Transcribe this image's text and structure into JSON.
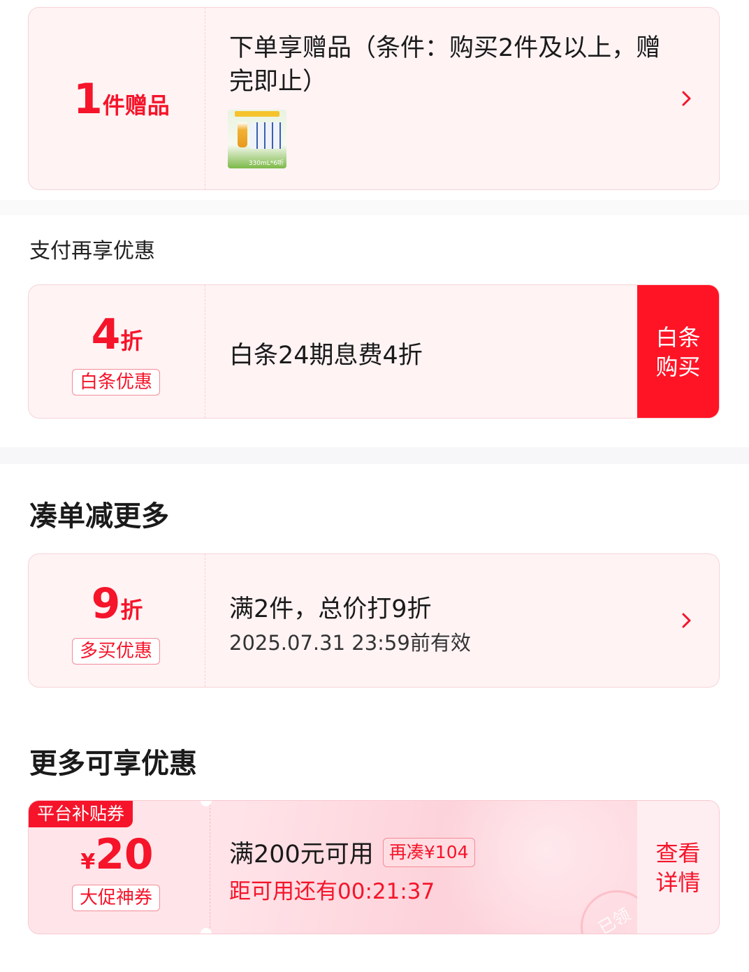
{
  "gift_card": {
    "count": "1",
    "unit": "件赠品",
    "title": "下单享赠品（条件：购买2件及以上，赠完即止）",
    "thumb_icon": "beer-pack-thumbnail",
    "thumb_caption": "330mL*6听"
  },
  "payment_section": {
    "title": "支付再享优惠"
  },
  "baitiao_card": {
    "discount_num": "4",
    "discount_unit": "折",
    "tag": "白条优惠",
    "desc": "白条24期息费4折",
    "button_line1": "白条",
    "button_line2": "购买"
  },
  "combo_section": {
    "title": "凑单减更多"
  },
  "multibuy_card": {
    "discount_num": "9",
    "discount_unit": "折",
    "tag": "多买优惠",
    "desc": "满2件，总价打9折",
    "validity": "2025.07.31 23:59前有效"
  },
  "more_section": {
    "title": "更多可享优惠"
  },
  "coupon_card": {
    "corner_label": "平台补贴券",
    "currency": "¥",
    "amount": "20",
    "tag": "大促神券",
    "condition": "满200元可用",
    "extra_badge": "再凑¥104",
    "countdown": "距可用还有00:21:37",
    "button_line1": "查看",
    "button_line2": "详情",
    "stamp": "已领"
  },
  "colors": {
    "accent": "#f5142a",
    "card_bg": "#fff3f4",
    "band_bg": "#f7f7f9"
  }
}
